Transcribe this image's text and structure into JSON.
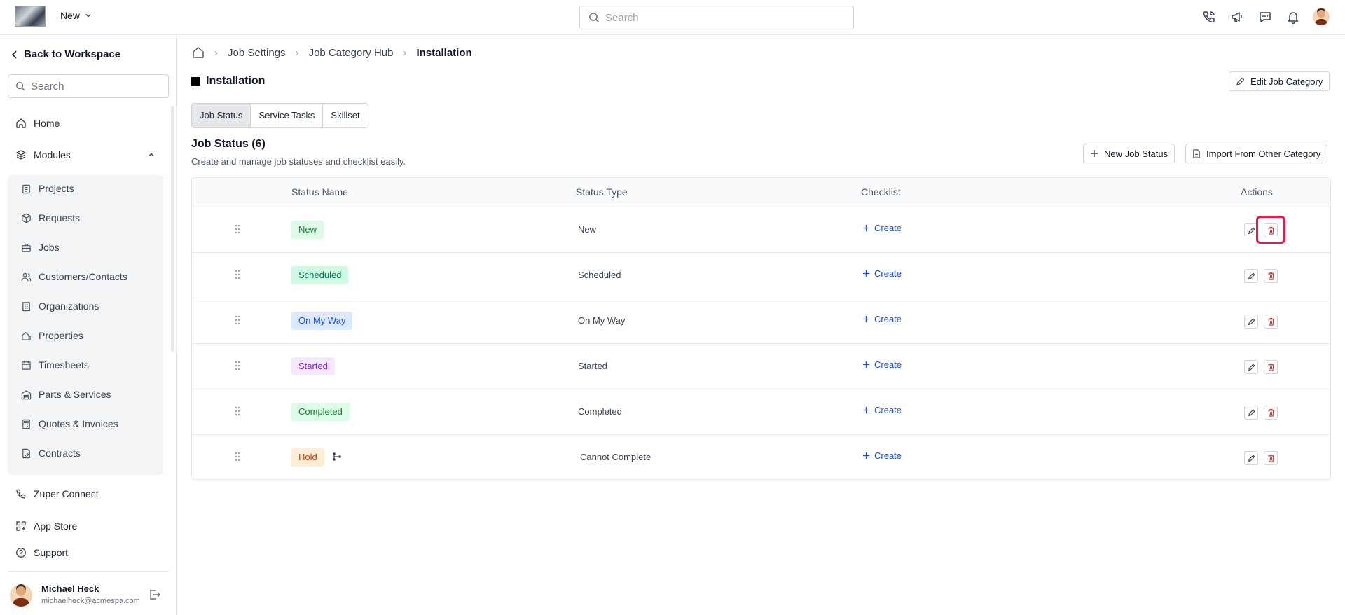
{
  "topbar": {
    "workspace": "New",
    "search_placeholder": "Search"
  },
  "sidebar": {
    "back_label": "Back to Workspace",
    "search_placeholder": "Search",
    "home": "Home",
    "modules": "Modules",
    "module_items": [
      "Projects",
      "Requests",
      "Jobs",
      "Customers/Contacts",
      "Organizations",
      "Properties",
      "Timesheets",
      "Parts & Services",
      "Quotes & Invoices",
      "Contracts"
    ],
    "zuper_connect": "Zuper Connect",
    "app_store": "App Store",
    "support": "Support",
    "user": {
      "name": "Michael Heck",
      "email": "michaelheck@acmespa.com"
    }
  },
  "breadcrumb": [
    "Job Settings",
    "Job Category Hub",
    "Installation"
  ],
  "page": {
    "title": "Installation",
    "edit_button": "Edit Job Category",
    "tabs": [
      "Job Status",
      "Service Tasks",
      "Skillset"
    ],
    "section_title": "Job Status (6)",
    "section_desc": "Create and manage job statuses and checklist easily.",
    "new_status_button": "New Job Status",
    "import_button": "Import From Other Category"
  },
  "table": {
    "headers": [
      "Status Name",
      "Status Type",
      "Checklist",
      "Actions"
    ],
    "create_label": "Create",
    "rows": [
      {
        "name": "New",
        "type": "New",
        "bg": "#dcfce7",
        "fg": "#15803d"
      },
      {
        "name": "Scheduled",
        "type": "Scheduled",
        "bg": "#d1fae5",
        "fg": "#047857"
      },
      {
        "name": "On My Way",
        "type": "On My Way",
        "bg": "#dbeafe",
        "fg": "#1d4ed8"
      },
      {
        "name": "Started",
        "type": "Started",
        "bg": "#f3e8ff",
        "fg": "#7e22ce"
      },
      {
        "name": "Completed",
        "type": "Completed",
        "bg": "#dcfce7",
        "fg": "#15803d"
      },
      {
        "name": "Hold",
        "type": "Cannot Complete",
        "bg": "#ffedd5",
        "fg": "#c2410c"
      }
    ]
  },
  "colors": {
    "accent": "#1d4ed8",
    "delete": "#dc2626",
    "highlight": "#e11d48"
  }
}
